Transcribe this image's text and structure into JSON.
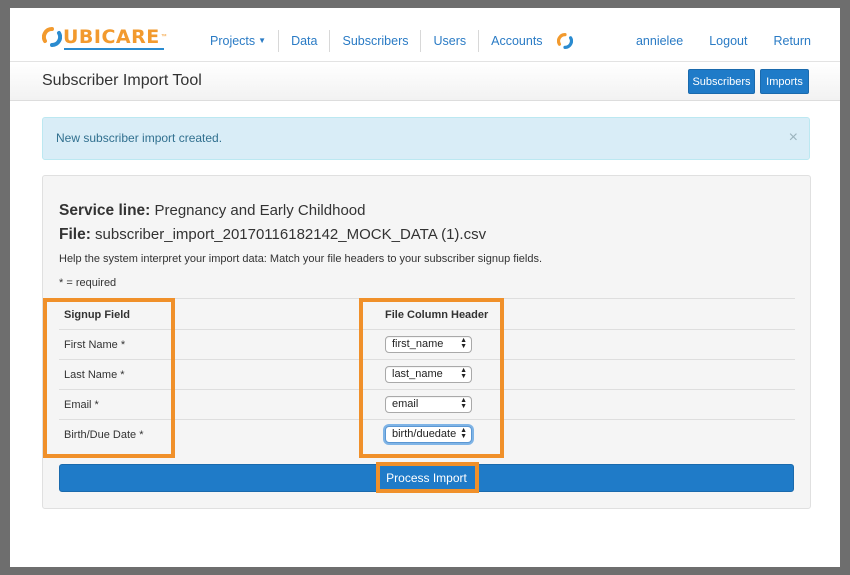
{
  "nav": {
    "logo_text": "UBICARE",
    "logo_tm": "™",
    "links": [
      "Projects",
      "Data",
      "Subscribers",
      "Users",
      "Accounts"
    ],
    "user": "annielee",
    "logout": "Logout",
    "return": "Return"
  },
  "header": {
    "title": "Subscriber Import Tool",
    "subscribers_button": "Subscribers",
    "imports_button": "Imports"
  },
  "alert": {
    "message": "New subscriber import created.",
    "close": "×"
  },
  "panel": {
    "service_label": "Service line:",
    "service_value": "Pregnancy and Early Childhood",
    "file_label": "File:",
    "file_value": "subscriber_import_20170116182142_MOCK_DATA (1).csv",
    "help_text": "Help the system interpret your import data: Match your file headers to your subscriber signup fields.",
    "required_note": "* = required",
    "columns": [
      "Signup Field",
      "File Column Header"
    ],
    "rows": [
      {
        "field": "First Name *",
        "header": "first_name"
      },
      {
        "field": "Last Name *",
        "header": "last_name"
      },
      {
        "field": "Email *",
        "header": "email"
      },
      {
        "field": "Birth/Due Date *",
        "header": "birth/duedate"
      }
    ],
    "process_button": "Process Import"
  },
  "colors": {
    "primary": "#1f7bc8",
    "highlight": "#f0902a",
    "alert_bg": "#d9edf7",
    "link": "#2a7bc5"
  }
}
